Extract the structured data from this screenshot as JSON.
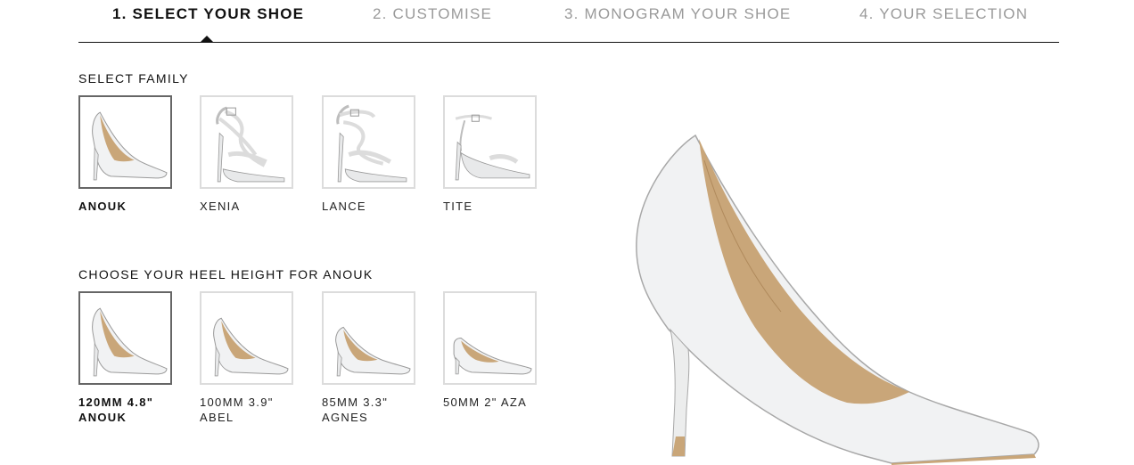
{
  "steps": [
    {
      "label": "1. SELECT YOUR SHOE",
      "active": true
    },
    {
      "label": "2. CUSTOMISE",
      "active": false
    },
    {
      "label": "3. MONOGRAM YOUR SHOE",
      "active": false
    },
    {
      "label": "4. YOUR SELECTION",
      "active": false
    }
  ],
  "family": {
    "title": "SELECT FAMILY",
    "options": [
      {
        "label": "ANOUK",
        "selected": true,
        "icon": "pump-shoe-icon"
      },
      {
        "label": "XENIA",
        "selected": false,
        "icon": "strappy-sandal-icon"
      },
      {
        "label": "LANCE",
        "selected": false,
        "icon": "strappy-sandal-icon"
      },
      {
        "label": "TITE",
        "selected": false,
        "icon": "ankle-strap-sandal-icon"
      }
    ]
  },
  "heel": {
    "title": "CHOOSE YOUR HEEL HEIGHT FOR ANOUK",
    "options": [
      {
        "label": "120MM 4.8\"\nANOUK",
        "selected": true
      },
      {
        "label": "100MM 3.9\"\nABEL",
        "selected": false
      },
      {
        "label": "85MM 3.3\"\nAGNES",
        "selected": false
      },
      {
        "label": "50MM 2\" AZA",
        "selected": false
      }
    ]
  },
  "colors": {
    "shoe_body": "#f1f2f3",
    "shoe_lining": "#c9a679",
    "outline": "#9a9a9a",
    "selected_border": "#666666",
    "thumb_border": "#dcdcdc"
  }
}
